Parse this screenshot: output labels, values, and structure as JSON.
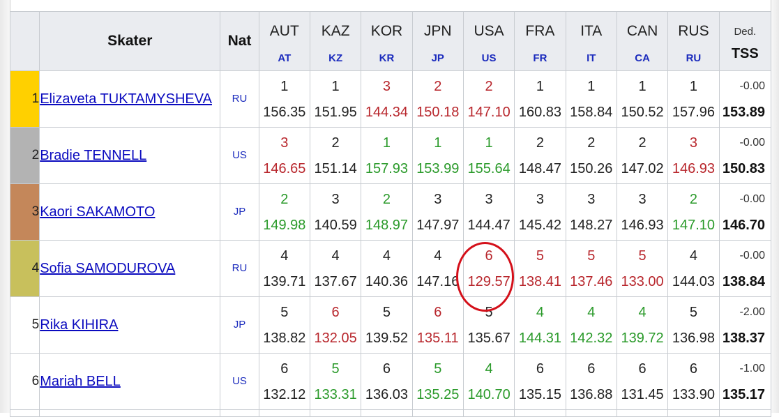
{
  "header": {
    "skater": "Skater",
    "nat": "Nat",
    "ded": "Ded.",
    "tss": "TSS",
    "countries": [
      {
        "top": "AUT",
        "bot": "AT"
      },
      {
        "top": "KAZ",
        "bot": "KZ"
      },
      {
        "top": "KOR",
        "bot": "KR"
      },
      {
        "top": "JPN",
        "bot": "JP"
      },
      {
        "top": "USA",
        "bot": "US"
      },
      {
        "top": "FRA",
        "bot": "FR"
      },
      {
        "top": "ITA",
        "bot": "IT"
      },
      {
        "top": "CAN",
        "bot": "CA"
      },
      {
        "top": "RUS",
        "bot": "RU"
      }
    ]
  },
  "rows": [
    {
      "rank": "1",
      "name": "Elizaveta TUKTAMYSHEVA",
      "nat": "RU",
      "rank_color": "#ffd000",
      "places": [
        "1",
        "1",
        "3",
        "2",
        "2",
        "1",
        "1",
        "1",
        "1"
      ],
      "scores": [
        "156.35",
        "151.95",
        "144.34",
        "150.18",
        "147.10",
        "160.83",
        "158.84",
        "150.52",
        "157.96"
      ],
      "colors": [
        "",
        "",
        "red",
        "red",
        "red",
        "",
        "",
        "",
        ""
      ],
      "ded": "-0.00",
      "tss": "153.89"
    },
    {
      "rank": "2",
      "name": "Bradie TENNELL",
      "nat": "US",
      "rank_color": "#b3b3b3",
      "places": [
        "3",
        "2",
        "1",
        "1",
        "1",
        "2",
        "2",
        "2",
        "3"
      ],
      "scores": [
        "146.65",
        "151.14",
        "157.93",
        "153.99",
        "155.64",
        "148.47",
        "150.26",
        "147.02",
        "146.93"
      ],
      "colors": [
        "red",
        "",
        "green",
        "green",
        "green",
        "",
        "",
        "",
        "red"
      ],
      "ded": "-0.00",
      "tss": "150.83"
    },
    {
      "rank": "3",
      "name": "Kaori SAKAMOTO",
      "nat": "JP",
      "rank_color": "#c4875a",
      "places": [
        "2",
        "3",
        "2",
        "3",
        "3",
        "3",
        "3",
        "3",
        "2"
      ],
      "scores": [
        "149.98",
        "140.59",
        "148.97",
        "147.97",
        "144.47",
        "145.42",
        "148.27",
        "146.93",
        "147.10"
      ],
      "colors": [
        "green",
        "",
        "green",
        "",
        "",
        "",
        "",
        "",
        "green"
      ],
      "ded": "-0.00",
      "tss": "146.70"
    },
    {
      "rank": "4",
      "name": "Sofia SAMODUROVA",
      "nat": "RU",
      "rank_color": "#c8c05c",
      "places": [
        "4",
        "4",
        "4",
        "4",
        "6",
        "5",
        "5",
        "5",
        "4"
      ],
      "scores": [
        "139.71",
        "137.67",
        "140.36",
        "147.16",
        "129.57",
        "138.41",
        "137.46",
        "133.00",
        "144.03"
      ],
      "colors": [
        "",
        "",
        "",
        "",
        "red",
        "red",
        "red",
        "red",
        ""
      ],
      "ded": "-0.00",
      "tss": "138.84"
    },
    {
      "rank": "5",
      "name": "Rika KIHIRA",
      "nat": "JP",
      "rank_color": "#ffffff",
      "places": [
        "5",
        "6",
        "5",
        "6",
        "5",
        "4",
        "4",
        "4",
        "5"
      ],
      "scores": [
        "138.82",
        "132.05",
        "139.52",
        "135.11",
        "135.67",
        "144.31",
        "142.32",
        "139.72",
        "136.98"
      ],
      "colors": [
        "",
        "red",
        "",
        "red",
        "",
        "green",
        "green",
        "green",
        ""
      ],
      "ded": "-2.00",
      "tss": "138.37"
    },
    {
      "rank": "6",
      "name": "Mariah BELL",
      "nat": "US",
      "rank_color": "#ffffff",
      "places": [
        "6",
        "5",
        "6",
        "5",
        "4",
        "6",
        "6",
        "6",
        "6"
      ],
      "scores": [
        "132.12",
        "133.31",
        "136.03",
        "135.25",
        "140.70",
        "135.15",
        "136.88",
        "131.45",
        "133.90"
      ],
      "colors": [
        "",
        "green",
        "",
        "green",
        "green",
        "",
        "",
        "",
        ""
      ],
      "ded": "-1.00",
      "tss": "135.17"
    }
  ],
  "colors": {
    "red": "#b8262c",
    "green": "#2a9a2a",
    "link": "#0b0bbf",
    "annotation": "#d4101a"
  }
}
